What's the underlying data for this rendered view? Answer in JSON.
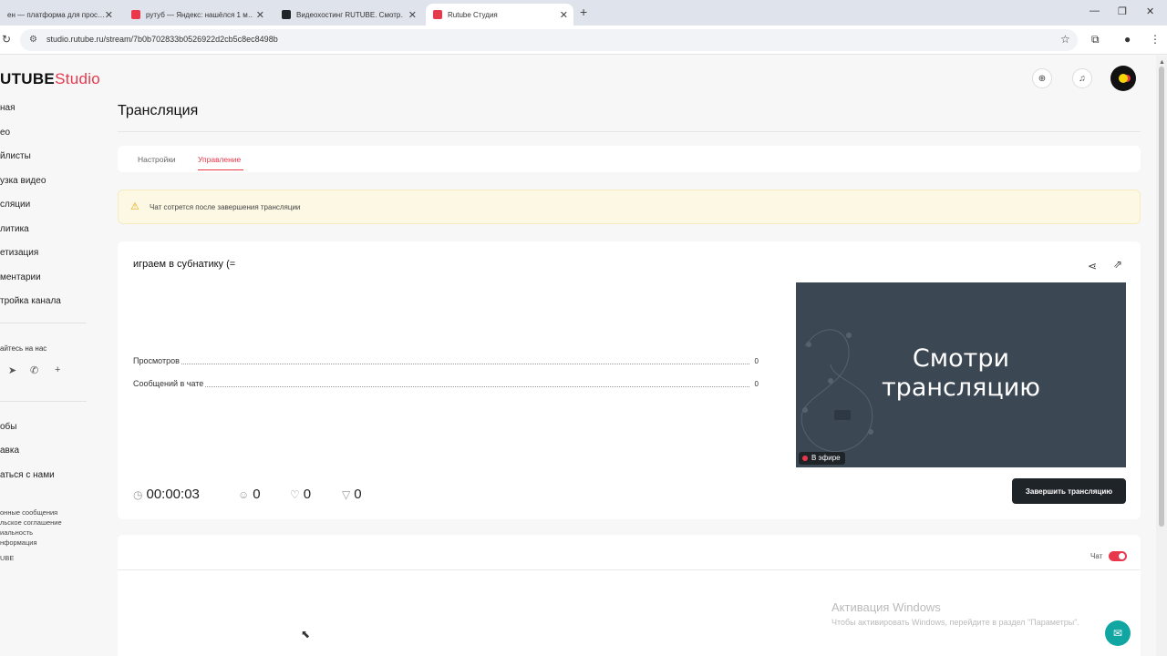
{
  "browser": {
    "tabs": [
      {
        "title": "ен — платформа для прос…",
        "favicon_color": "#e9384c",
        "active": false
      },
      {
        "title": "рутуб — Яндекс: нашёлся 1 м…",
        "favicon_color": "#e9384c",
        "active": false
      },
      {
        "title": "Видеохостинг RUTUBE. Смотр…",
        "favicon_color": "#1f2429",
        "active": false
      },
      {
        "title": "Rutube Студия",
        "favicon_color": "#e9384c",
        "active": true
      }
    ],
    "url": "studio.rutube.ru/stream/7b0b702833b0526922d2cb5c8ec8498b"
  },
  "app": {
    "logo_main": "UTUBE",
    "logo_sub": "Studio",
    "accent_color": "#e9384c"
  },
  "sidebar": {
    "items": [
      "ная",
      "ео",
      "йлисты",
      "узка видео",
      "сляции",
      "литика",
      "етизация",
      "ментарии",
      "тройка канала"
    ],
    "social_label": "айтесь на нас",
    "bottom_items": [
      "обы",
      "авка",
      "аться с нами"
    ],
    "footer_links": [
      "онные сообщения",
      "льское соглашение",
      "иальность",
      "нформация",
      "UBE"
    ]
  },
  "page": {
    "title": "Трансляция",
    "tabs": [
      {
        "label": "Настройки",
        "active": false
      },
      {
        "label": "Управление",
        "active": true
      }
    ],
    "alert": "Чат сотрется после завершения трансляции"
  },
  "stream": {
    "title": "играем в субнатику (=",
    "stats": [
      {
        "label": "Просмотров",
        "value": "0"
      },
      {
        "label": "Сообщений в чате",
        "value": "0"
      }
    ],
    "duration": "00:00:03",
    "viewers": "0",
    "likes": "0",
    "dislikes": "0",
    "preview_line1": "Смотри",
    "preview_line2": "трансляцию",
    "live_badge": "В эфире",
    "end_button": "Завершить трансляцию"
  },
  "chat": {
    "label": "Чат",
    "enabled": true
  },
  "overlay": {
    "activation_title": "Активация Windows",
    "activation_sub": "Чтобы активировать Windows, перейдите в раздел \"Параметры\"."
  }
}
